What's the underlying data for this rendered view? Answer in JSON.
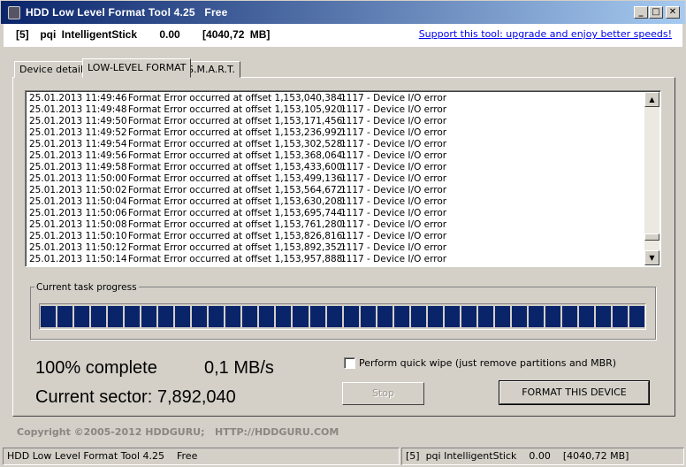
{
  "window": {
    "title": "HDD Low Level Format Tool 4.25   Free",
    "controls": {
      "minimize": "_",
      "maximize": "□",
      "close": "✕"
    }
  },
  "header": {
    "device": "[5]  pqi IntelligentStick    0.00    [4040,72 MB]",
    "support_link": "Support this tool: upgrade and enjoy better speeds!"
  },
  "tabs": [
    {
      "label": "Device details"
    },
    {
      "label": "LOW-LEVEL FORMAT"
    },
    {
      "label": "S.M.A.R.T."
    }
  ],
  "log": [
    {
      "time": "25.01.2013 11:49:46",
      "msg": "Format Error occurred at offset 1,153,040,384:",
      "err": "1117 - Device I/O error"
    },
    {
      "time": "25.01.2013 11:49:48",
      "msg": "Format Error occurred at offset 1,153,105,920:",
      "err": "1117 - Device I/O error"
    },
    {
      "time": "25.01.2013 11:49:50",
      "msg": "Format Error occurred at offset 1,153,171,456:",
      "err": "1117 - Device I/O error"
    },
    {
      "time": "25.01.2013 11:49:52",
      "msg": "Format Error occurred at offset 1,153,236,992:",
      "err": "1117 - Device I/O error"
    },
    {
      "time": "25.01.2013 11:49:54",
      "msg": "Format Error occurred at offset 1,153,302,528:",
      "err": "1117 - Device I/O error"
    },
    {
      "time": "25.01.2013 11:49:56",
      "msg": "Format Error occurred at offset 1,153,368,064:",
      "err": "1117 - Device I/O error"
    },
    {
      "time": "25.01.2013 11:49:58",
      "msg": "Format Error occurred at offset 1,153,433,600:",
      "err": "1117 - Device I/O error"
    },
    {
      "time": "25.01.2013 11:50:00",
      "msg": "Format Error occurred at offset 1,153,499,136:",
      "err": "1117 - Device I/O error"
    },
    {
      "time": "25.01.2013 11:50:02",
      "msg": "Format Error occurred at offset 1,153,564,672:",
      "err": "1117 - Device I/O error"
    },
    {
      "time": "25.01.2013 11:50:04",
      "msg": "Format Error occurred at offset 1,153,630,208:",
      "err": "1117 - Device I/O error"
    },
    {
      "time": "25.01.2013 11:50:06",
      "msg": "Format Error occurred at offset 1,153,695,744:",
      "err": "1117 - Device I/O error"
    },
    {
      "time": "25.01.2013 11:50:08",
      "msg": "Format Error occurred at offset 1,153,761,280:",
      "err": "1117 - Device I/O error"
    },
    {
      "time": "25.01.2013 11:50:10",
      "msg": "Format Error occurred at offset 1,153,826,816:",
      "err": "1117 - Device I/O error"
    },
    {
      "time": "25.01.2013 11:50:12",
      "msg": "Format Error occurred at offset 1,153,892,352:",
      "err": "1117 - Device I/O error"
    },
    {
      "time": "25.01.2013 11:50:14",
      "msg": "Format Error occurred at offset 1,153,957,888:",
      "err": "1117 - Device I/O error"
    }
  ],
  "progress": {
    "label": "Current task progress",
    "percent": 100,
    "blocks": 36,
    "complete_text": "100% complete",
    "speed": "0,1 MB/s",
    "sector_text": "Current sector: 7,892,040"
  },
  "options": {
    "quick_wipe": "Perform quick wipe (just remove partitions and MBR)",
    "quick_wipe_checked": false
  },
  "buttons": {
    "stop": "Stop",
    "format": "FORMAT THIS DEVICE"
  },
  "footer": {
    "copyright": "Copyright ©2005-2012 HDDGURU;   HTTP://HDDGURU.COM"
  },
  "statusbar": {
    "left": "HDD Low Level Format Tool 4.25    Free",
    "right": "[5]  pqi IntelligentStick    0.00    [4040,72 MB]"
  },
  "colors": {
    "progress": "#0a246a",
    "link": "#0000ee"
  }
}
